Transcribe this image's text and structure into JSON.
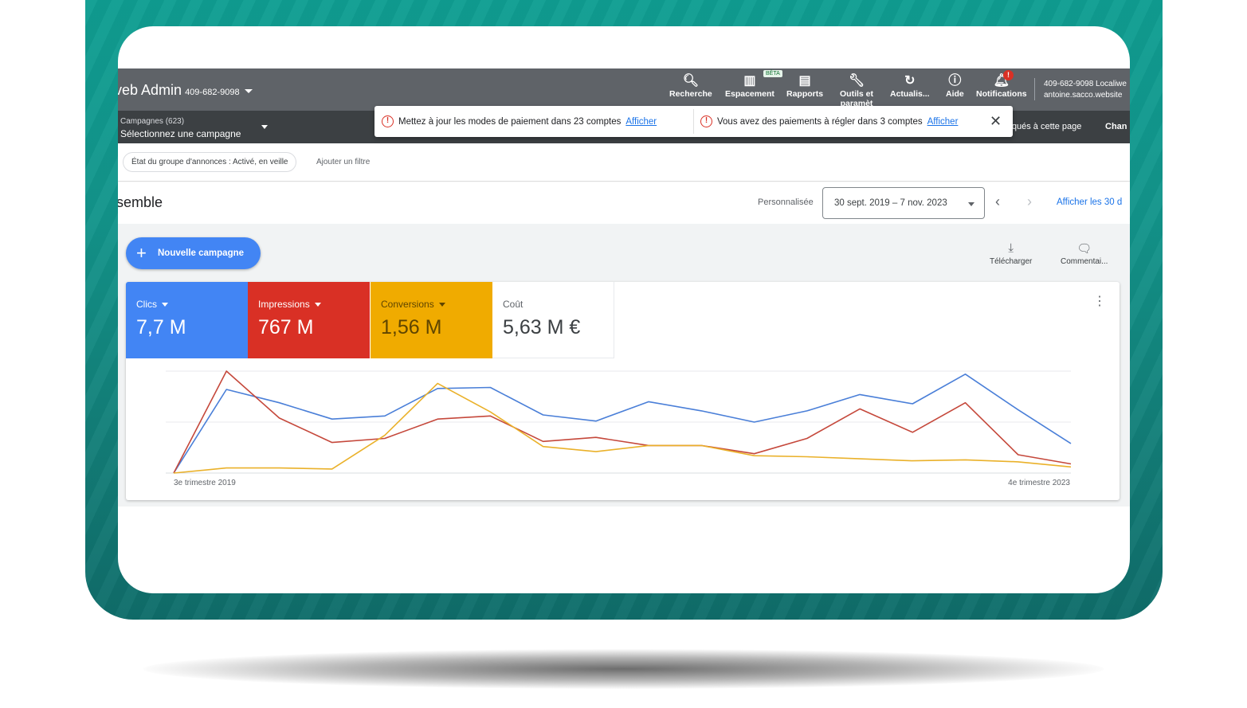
{
  "topbar": {
    "app_title": "veb Admin",
    "account_id": "409-682-9098",
    "beta_badge": "BÊTA",
    "notification_badge": "!",
    "tools": [
      {
        "label": "Recherche",
        "icon": "search-icon"
      },
      {
        "label": "Espacement",
        "icon": "workspace-icon"
      },
      {
        "label": "Rapports",
        "icon": "reports-icon"
      },
      {
        "label": "Outils et paramèt",
        "icon": "wrench-icon"
      },
      {
        "label": "Actualis...",
        "icon": "refresh-icon"
      },
      {
        "label": "Aide",
        "icon": "help-icon"
      },
      {
        "label": "Notifications",
        "icon": "bell-icon"
      }
    ],
    "user_line1": "409-682-9098 Localiwe",
    "user_line2": "antoine.sacco.website"
  },
  "subbar": {
    "campaigns_count": "Campagnes (623)",
    "select_campaign": "Sélectionnez une campagne",
    "applied_filters": "liqués à cette page",
    "change": "Chan"
  },
  "alerts": [
    {
      "text": "Mettez à jour les modes de paiement dans 23 comptes",
      "link": "Afficher"
    },
    {
      "text": "Vous avez des paiements à régler dans 3 comptes",
      "link": "Afficher"
    }
  ],
  "filters": {
    "chip": "État du groupe d'annonces : Activé, en veille",
    "add_filter": "Ajouter un filtre"
  },
  "header": {
    "title": "semble",
    "period_type": "Personnalisée",
    "date_range": "30 sept. 2019 – 7 nov. 2023",
    "show_last": "Afficher les 30 d"
  },
  "actions": {
    "new_campaign": "Nouvelle campagne",
    "download": "Télécharger",
    "comments": "Commentai..."
  },
  "metrics": [
    {
      "label": "Clics",
      "value": "7,7 M",
      "color": "#4285f4"
    },
    {
      "label": "Impressions",
      "value": "767 M",
      "color": "#d93025"
    },
    {
      "label": "Conversions",
      "value": "1,56 M",
      "color": "#f0ab00"
    },
    {
      "label": "Coût",
      "value": "5,63 M €",
      "color": "#ffffff"
    }
  ],
  "chart_data": {
    "type": "line",
    "x_start_label": "3e trimestre 2019",
    "x_end_label": "4e trimestre 2023",
    "point_count": 18,
    "y_range": [
      0,
      100
    ],
    "grid": true,
    "series": [
      {
        "color": "#4a7fd8",
        "values": [
          0,
          82,
          69,
          53,
          56,
          83,
          84,
          57,
          51,
          70,
          61,
          50,
          61,
          77,
          68,
          97,
          62,
          29
        ]
      },
      {
        "color": "#c5483b",
        "values": [
          0,
          100,
          54,
          30,
          34,
          53,
          56,
          31,
          35,
          27,
          27,
          19,
          34,
          63,
          40,
          69,
          18,
          9
        ]
      },
      {
        "color": "#eab12a",
        "values": [
          0,
          5,
          5,
          4,
          37,
          88,
          60,
          26,
          21,
          27,
          27,
          17,
          16,
          14,
          12,
          13,
          11,
          6
        ]
      }
    ]
  }
}
